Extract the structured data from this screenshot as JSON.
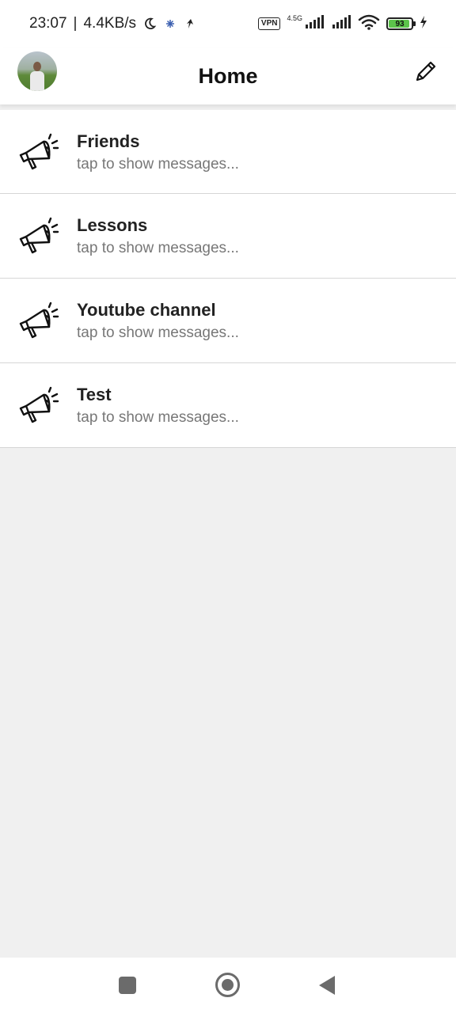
{
  "status_bar": {
    "time": "23:07",
    "separator": "|",
    "speed": "4.4KB/s",
    "vpn": "VPN",
    "network": "4.5G",
    "battery_level": "93",
    "battery_fraction": 0.93,
    "battery_color": "#5cc34b"
  },
  "app_bar": {
    "title": "Home"
  },
  "channels": [
    {
      "name": "Friends",
      "subtitle": "tap to show messages..."
    },
    {
      "name": "Lessons",
      "subtitle": "tap to show messages..."
    },
    {
      "name": "Youtube channel",
      "subtitle": "tap to show messages..."
    },
    {
      "name": "Test",
      "subtitle": "tap to show messages..."
    }
  ],
  "icons": {
    "status_left": [
      "moon-icon",
      "snowflake-icon",
      "app-notification-icon"
    ],
    "status_right": [
      "vpn-icon",
      "signal-icon",
      "signal-icon",
      "wifi-icon",
      "battery-icon",
      "charging-icon"
    ],
    "app_bar": [
      "avatar",
      "pencil-icon"
    ],
    "channel": "megaphone-icon",
    "nav": [
      "recents-square-icon",
      "home-circle-icon",
      "back-triangle-icon"
    ]
  }
}
